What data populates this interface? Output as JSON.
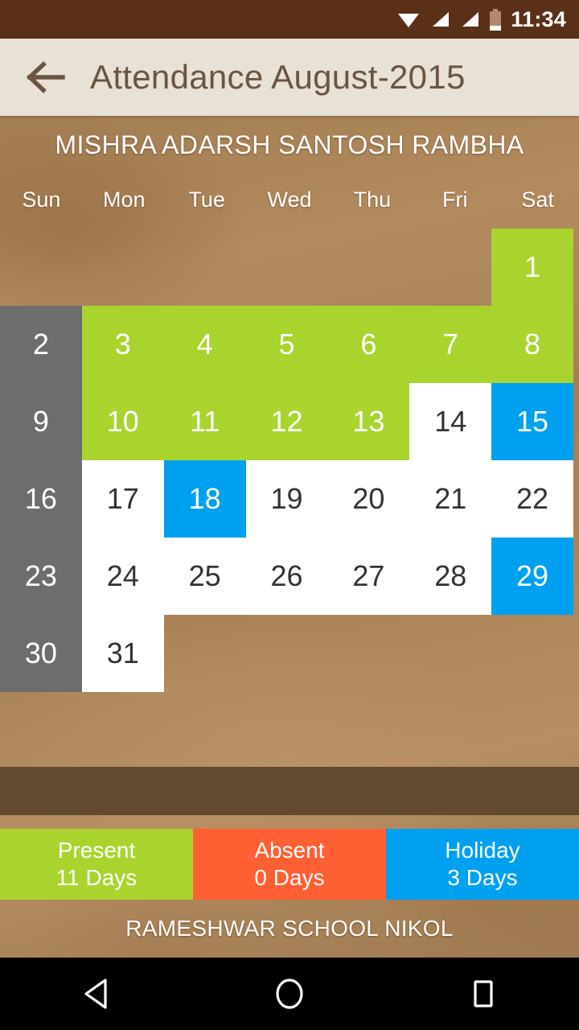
{
  "status_bar": {
    "time": "11:34",
    "icons": [
      "wifi-icon",
      "signal-icon",
      "signal-icon",
      "battery-icon"
    ]
  },
  "app_bar": {
    "back_icon": "back-arrow-icon",
    "title": "Attendance August-2015"
  },
  "student": {
    "name": "MISHRA ADARSH SANTOSH RAMBHA"
  },
  "calendar": {
    "weekdays": [
      "Sun",
      "Mon",
      "Tue",
      "Wed",
      "Thu",
      "Fri",
      "Sat"
    ],
    "month": "August",
    "year": "2015",
    "colors": {
      "present": "#a9d42e",
      "absent": "#ff5f33",
      "holiday": "#00a0f0",
      "weekend": "#6d6d6d",
      "plain": "#ffffff",
      "background": "#a9835a"
    },
    "cells": [
      {
        "label": "",
        "state": "empty"
      },
      {
        "label": "",
        "state": "empty"
      },
      {
        "label": "",
        "state": "empty"
      },
      {
        "label": "",
        "state": "empty"
      },
      {
        "label": "",
        "state": "empty"
      },
      {
        "label": "",
        "state": "empty"
      },
      {
        "label": "1",
        "state": "present"
      },
      {
        "label": "2",
        "state": "weekend"
      },
      {
        "label": "3",
        "state": "present"
      },
      {
        "label": "4",
        "state": "present"
      },
      {
        "label": "5",
        "state": "present"
      },
      {
        "label": "6",
        "state": "present"
      },
      {
        "label": "7",
        "state": "present"
      },
      {
        "label": "8",
        "state": "present"
      },
      {
        "label": "9",
        "state": "weekend"
      },
      {
        "label": "10",
        "state": "present"
      },
      {
        "label": "11",
        "state": "present"
      },
      {
        "label": "12",
        "state": "present"
      },
      {
        "label": "13",
        "state": "present"
      },
      {
        "label": "14",
        "state": "plain"
      },
      {
        "label": "15",
        "state": "holiday"
      },
      {
        "label": "16",
        "state": "weekend"
      },
      {
        "label": "17",
        "state": "plain"
      },
      {
        "label": "18",
        "state": "holiday"
      },
      {
        "label": "19",
        "state": "plain"
      },
      {
        "label": "20",
        "state": "plain"
      },
      {
        "label": "21",
        "state": "plain"
      },
      {
        "label": "22",
        "state": "plain"
      },
      {
        "label": "23",
        "state": "weekend"
      },
      {
        "label": "24",
        "state": "plain"
      },
      {
        "label": "25",
        "state": "plain"
      },
      {
        "label": "26",
        "state": "plain"
      },
      {
        "label": "27",
        "state": "plain"
      },
      {
        "label": "28",
        "state": "plain"
      },
      {
        "label": "29",
        "state": "holiday"
      },
      {
        "label": "30",
        "state": "weekend"
      },
      {
        "label": "31",
        "state": "plain"
      },
      {
        "label": "",
        "state": "empty"
      },
      {
        "label": "",
        "state": "empty"
      },
      {
        "label": "",
        "state": "empty"
      },
      {
        "label": "",
        "state": "empty"
      },
      {
        "label": "",
        "state": "empty"
      }
    ]
  },
  "legend": [
    {
      "label": "Present",
      "count": "11 Days",
      "color": "#a9d42e",
      "key": "present"
    },
    {
      "label": "Absent",
      "count": "0 Days",
      "color": "#ff5f33",
      "key": "absent"
    },
    {
      "label": "Holiday",
      "count": "3 Days",
      "color": "#00a0f0",
      "key": "holiday"
    }
  ],
  "school": {
    "name": "RAMESHWAR SCHOOL NIKOL"
  },
  "nav_bar": {
    "back": "nav-back-icon",
    "home": "nav-home-icon",
    "recents": "nav-recents-icon"
  }
}
